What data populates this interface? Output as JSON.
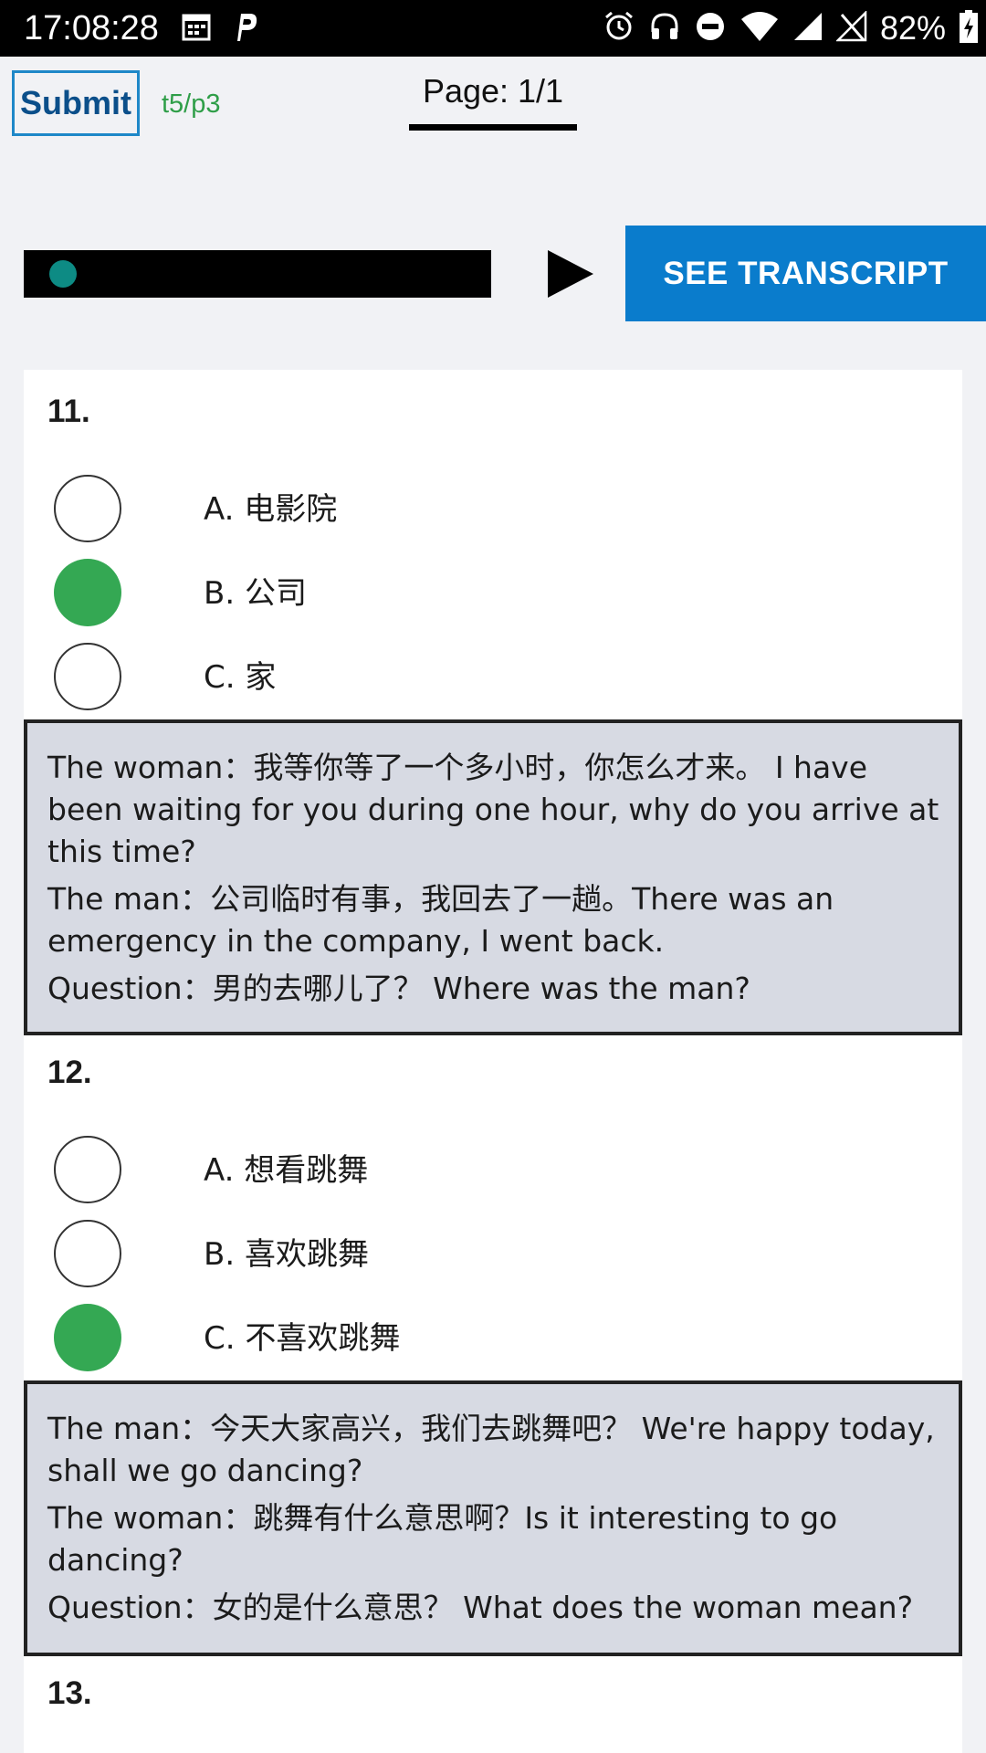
{
  "status_bar": {
    "time": "17:08:28",
    "battery": "82%"
  },
  "header": {
    "submit_label": "Submit",
    "test_code": "t5/p3",
    "page_indicator": "Page: 1/1"
  },
  "audio": {
    "progress": 0.04,
    "see_transcript_label": "SEE TRANSCRIPT"
  },
  "colors": {
    "accent_blue": "#0a7ccc",
    "selected_green": "#34a853",
    "transcript_bg": "#d7dae3"
  },
  "questions": [
    {
      "number": "11.",
      "options": [
        {
          "label": "A. 电影院",
          "selected": false
        },
        {
          "label": "B. 公司",
          "selected": true
        },
        {
          "label": "C. 家",
          "selected": false
        }
      ],
      "transcript": [
        "The woman：我等你等了一个多小时，你怎么才来。 I have been waiting for you during one hour, why do you arrive at this time?",
        "The man：公司临时有事，我回去了一趟。There was an emergency in the company, I went back.",
        "Question：男的去哪儿了？ Where was the man?"
      ]
    },
    {
      "number": "12.",
      "options": [
        {
          "label": "A. 想看跳舞",
          "selected": false
        },
        {
          "label": "B. 喜欢跳舞",
          "selected": false
        },
        {
          "label": "C. 不喜欢跳舞",
          "selected": true
        }
      ],
      "transcript": [
        "The man：今天大家高兴，我们去跳舞吧？ We're happy today, shall we go dancing?",
        "The woman：跳舞有什么意思啊？Is it interesting to go dancing?",
        "Question：女的是什么意思？ What does the woman mean?"
      ]
    },
    {
      "number": "13."
    }
  ]
}
